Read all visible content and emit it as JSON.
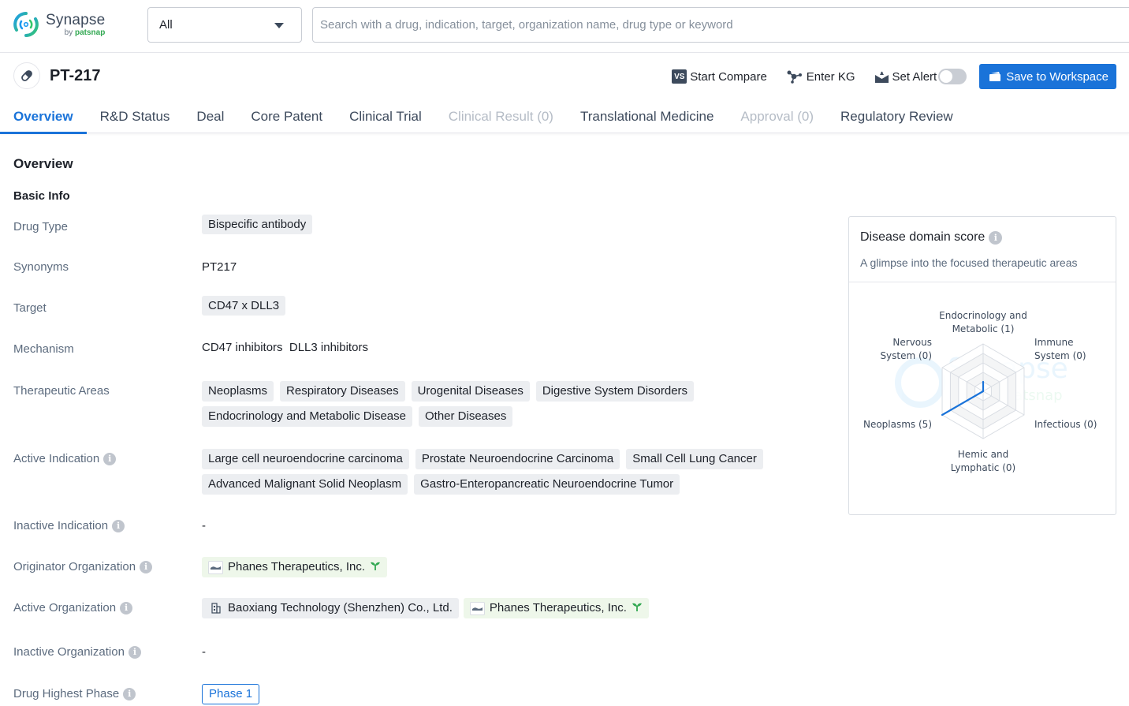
{
  "header": {
    "logo_title": "Synapse",
    "logo_by": "by",
    "logo_brand": "patsnap",
    "scope_select": "All",
    "search_placeholder": "Search with a drug, indication, target, organization name, drug type or keyword"
  },
  "drug": {
    "name": "PT-217",
    "icon": "pill-icon"
  },
  "actions": {
    "compare_badge": "VS",
    "compare_label": "Start Compare",
    "kg_label": "Enter KG",
    "alert_label": "Set Alert",
    "alert_enabled": false,
    "save_label": "Save to Workspace"
  },
  "tabs": [
    {
      "label": "Overview",
      "state": "active"
    },
    {
      "label": "R&D Status",
      "state": "normal"
    },
    {
      "label": "Deal",
      "state": "normal"
    },
    {
      "label": "Core Patent",
      "state": "normal"
    },
    {
      "label": "Clinical Trial",
      "state": "normal"
    },
    {
      "label": "Clinical Result (0)",
      "state": "disabled"
    },
    {
      "label": "Translational Medicine",
      "state": "normal"
    },
    {
      "label": "Approval (0)",
      "state": "disabled"
    },
    {
      "label": "Regulatory Review",
      "state": "normal"
    }
  ],
  "overview": {
    "title": "Overview",
    "basic_info_title": "Basic Info",
    "labels": {
      "drug_type": "Drug Type",
      "synonyms": "Synonyms",
      "target": "Target",
      "mechanism": "Mechanism",
      "therapeutic_areas": "Therapeutic Areas",
      "active_indication": "Active Indication",
      "inactive_indication": "Inactive Indication",
      "originator_org": "Originator Organization",
      "active_org": "Active Organization",
      "inactive_org": "Inactive Organization",
      "highest_phase": "Drug Highest Phase"
    },
    "drug_type": "Bispecific antibody",
    "synonyms": "PT217",
    "target": "CD47 x DLL3",
    "mechanism": "CD47 inhibitors  DLL3 inhibitors",
    "therapeutic_areas": [
      "Neoplasms",
      "Respiratory Diseases",
      "Urogenital Diseases",
      "Digestive System Disorders",
      "Endocrinology and Metabolic Disease",
      "Other Diseases"
    ],
    "active_indication": [
      "Large cell neuroendocrine carcinoma",
      "Prostate Neuroendocrine Carcinoma",
      "Small Cell Lung Cancer",
      "Advanced Malignant Solid Neoplasm",
      "Gastro-Enteropancreatic Neuroendocrine Tumor"
    ],
    "inactive_indication": "-",
    "originator_org": [
      {
        "name": "Phanes Therapeutics, Inc.",
        "type": "company",
        "startup": true
      }
    ],
    "active_org": [
      {
        "name": "Baoxiang Technology (Shenzhen) Co., Ltd.",
        "type": "building",
        "startup": false
      },
      {
        "name": "Phanes Therapeutics, Inc.",
        "type": "company",
        "startup": true
      }
    ],
    "inactive_org": "-",
    "highest_phase": "Phase 1"
  },
  "disease_domain": {
    "title": "Disease domain score",
    "subtitle": "A glimpse into the focused therapeutic areas"
  },
  "chart_data": {
    "type": "radar",
    "title": "Disease domain score",
    "axes": [
      {
        "label": "Endocrinology and Metabolic",
        "value": 1
      },
      {
        "label": "Immune System",
        "value": 0
      },
      {
        "label": "Infectious",
        "value": 0
      },
      {
        "label": "Hemic and Lymphatic",
        "value": 0
      },
      {
        "label": "Neoplasms",
        "value": 5
      },
      {
        "label": "Nervous System",
        "value": 0
      }
    ],
    "range": [
      0,
      5
    ],
    "rings": 5,
    "series_color": "#1a73d9"
  },
  "colors": {
    "accent": "#1a73d9",
    "startup_green": "#32a852",
    "tag_bg": "#eceef1",
    "org_bg": "#eef7ea"
  }
}
